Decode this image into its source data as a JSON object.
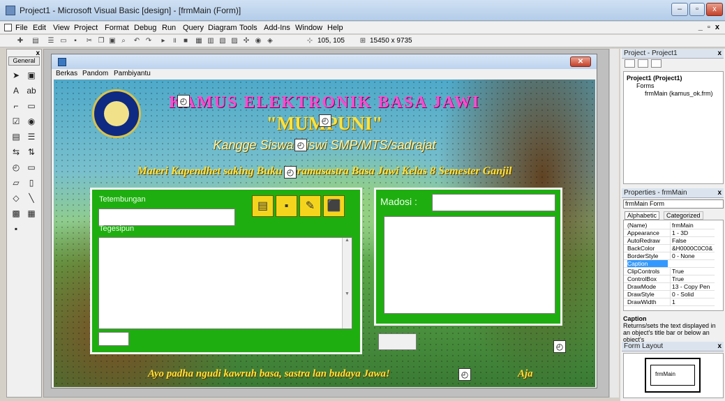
{
  "titlebar": {
    "title": "Project1 - Microsoft Visual Basic [design] - [frmMain (Form)]",
    "min": "–",
    "max": "▫",
    "close": "x"
  },
  "menubar": {
    "items": [
      "File",
      "Edit",
      "View",
      "Project",
      "Format",
      "Debug",
      "Run",
      "Query",
      "Diagram",
      "Tools",
      "Add-Ins",
      "Window",
      "Help"
    ],
    "mdi_controls": "_ ▫ x"
  },
  "toolbar": {
    "position": "105, 105",
    "size": "15450 x 9735"
  },
  "toolbox": {
    "title": "General",
    "close": "x"
  },
  "form": {
    "menu": [
      "Berkas",
      "Pandom",
      "Pambiyantu"
    ],
    "title1": "KAMUS ELEKTRONIK BASA JAWI",
    "title2": "\"MUMPUNI\"",
    "subtitle": "Kangge Siswa-Siswi SMP/MTS/sadrajat",
    "subtitle2": "Materi Kapendhet saking Buku Paramasastra Basa Jawi Kelas 8 Semester Ganjil",
    "left_panel": {
      "label_word": "Tetembungan",
      "label_meaning": "Tegesipun"
    },
    "right_panel": {
      "label_search": "Madosi :"
    },
    "footer": "Ayo padha ngudi kawruh basa, sastra lan budaya Jawa!",
    "footer_right": "Aja"
  },
  "project_explorer": {
    "title": "Project - Project1",
    "tree": {
      "project": "Project1 (Project1)",
      "folder": "Forms",
      "form": "frmMain (kamus_ok.frm)"
    }
  },
  "properties": {
    "title": "Properties - frmMain",
    "object": "frmMain Form",
    "tabs": [
      "Alphabetic",
      "Categorized"
    ],
    "rows": [
      {
        "name": "(Name)",
        "value": "frmMain"
      },
      {
        "name": "Appearance",
        "value": "1 - 3D"
      },
      {
        "name": "AutoRedraw",
        "value": "False"
      },
      {
        "name": "BackColor",
        "value": "&H0000C0C0&"
      },
      {
        "name": "BorderStyle",
        "value": "0 - None"
      },
      {
        "name": "Caption",
        "value": ""
      },
      {
        "name": "ClipControls",
        "value": "True"
      },
      {
        "name": "ControlBox",
        "value": "True"
      },
      {
        "name": "DrawMode",
        "value": "13 - Copy Pen"
      },
      {
        "name": "DrawStyle",
        "value": "0 - Solid"
      },
      {
        "name": "DrawWidth",
        "value": "1"
      }
    ],
    "desc_title": "Caption",
    "desc_text": "Returns/sets the text displayed in an object's title bar or below an object's"
  },
  "form_layout": {
    "title": "Form Layout",
    "preview": "frmMain"
  },
  "colors": {
    "panel_green": "#1fae10",
    "title_pink": "#ff4bd0",
    "title_yellow": "#ffe23a",
    "button_yellow": "#f5d41e"
  }
}
